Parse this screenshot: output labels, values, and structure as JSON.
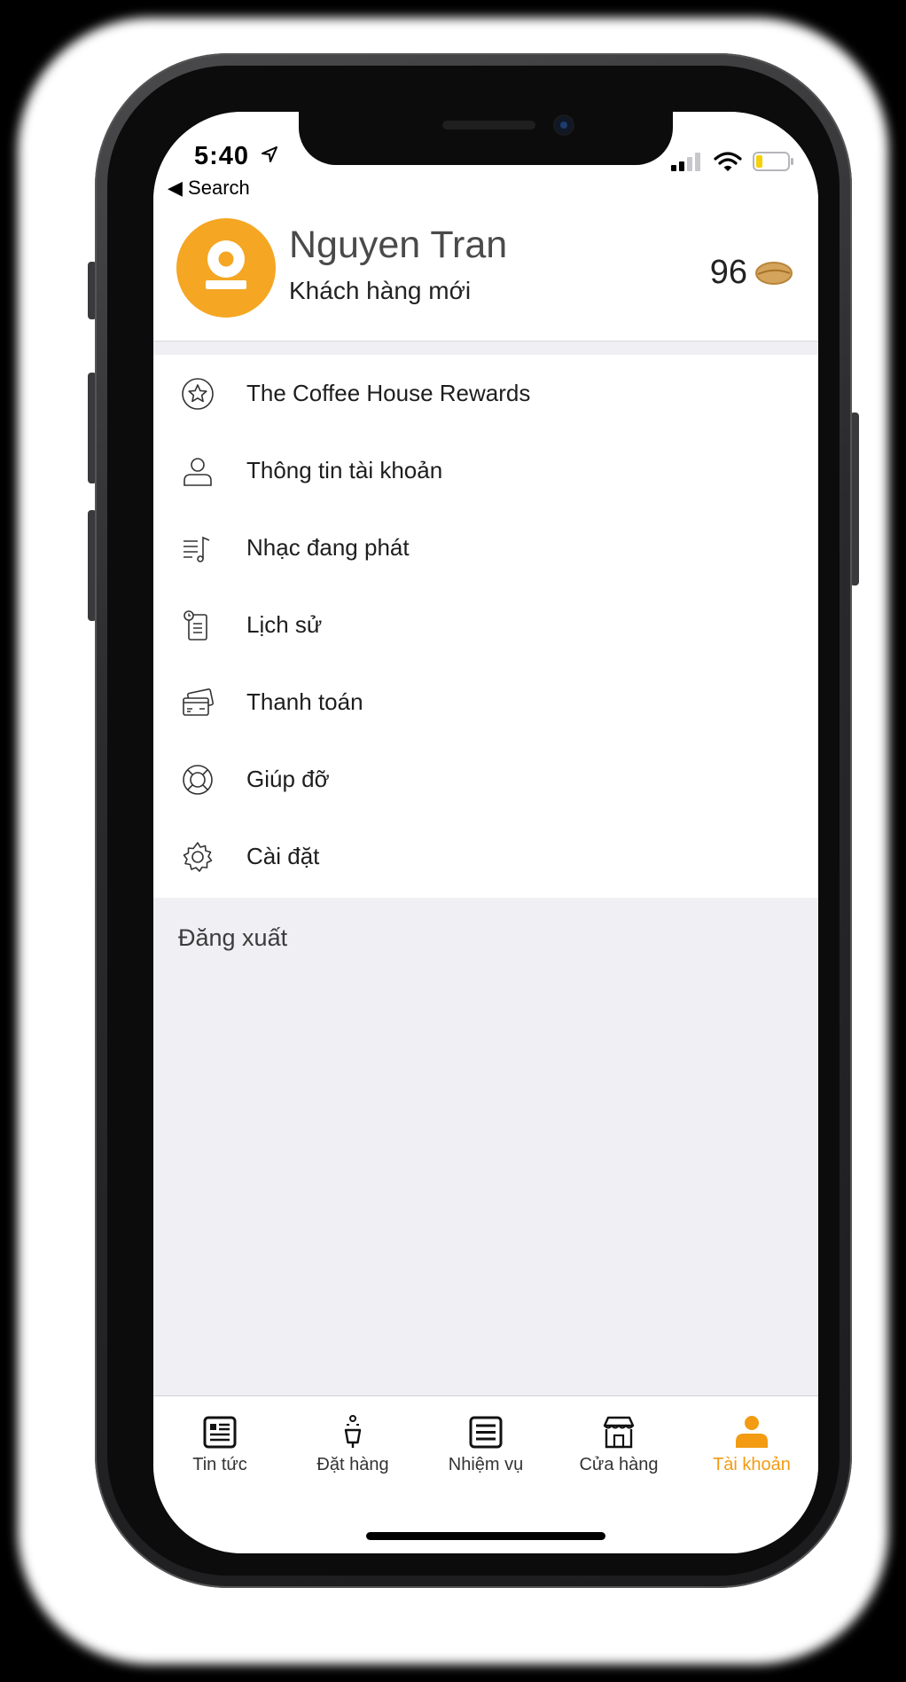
{
  "status_bar": {
    "time": "5:40",
    "back_label": "Search"
  },
  "profile": {
    "name": "Nguyen Tran",
    "tier": "Khách hàng mới",
    "beans": "96"
  },
  "menu": {
    "items": [
      {
        "label": "The Coffee House Rewards",
        "icon": "star-circle-icon"
      },
      {
        "label": "Thông tin tài khoản",
        "icon": "user-icon"
      },
      {
        "label": "Nhạc đang phát",
        "icon": "music-list-icon"
      },
      {
        "label": "Lịch sử",
        "icon": "history-icon"
      },
      {
        "label": "Thanh toán",
        "icon": "payment-card-icon"
      },
      {
        "label": "Giúp đỡ",
        "icon": "lifebuoy-icon"
      },
      {
        "label": "Cài đặt",
        "icon": "gear-icon"
      }
    ]
  },
  "logout_label": "Đăng xuất",
  "tabs": [
    {
      "label": "Tin tức",
      "icon": "news-icon"
    },
    {
      "label": "Đặt hàng",
      "icon": "order-icon"
    },
    {
      "label": "Nhiệm vụ",
      "icon": "tasks-icon"
    },
    {
      "label": "Cửa hàng",
      "icon": "store-icon"
    },
    {
      "label": "Tài khoản",
      "icon": "account-icon",
      "active": true
    }
  ],
  "colors": {
    "accent": "#f29b13",
    "avatar": "#f5a623",
    "background": "#efeff4"
  }
}
